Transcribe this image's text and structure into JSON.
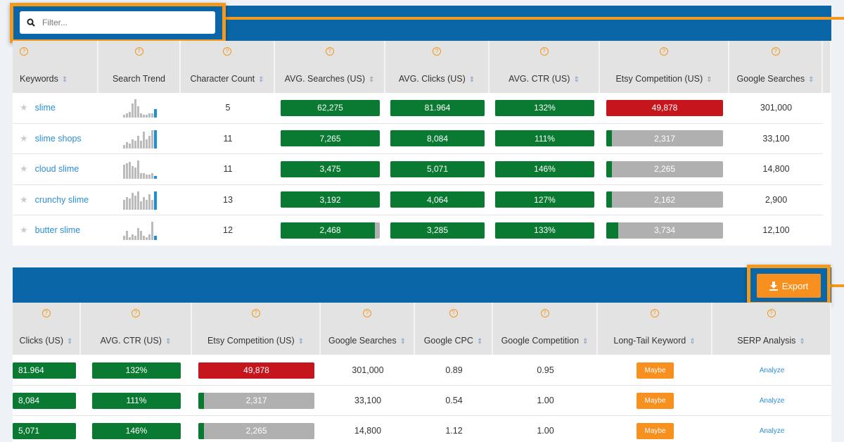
{
  "colors": {
    "header_blue": "#0a66a6",
    "highlight": "#f39a1e",
    "green": "#0a7a32",
    "red": "#c4161c",
    "gray": "#b0b0b0",
    "link": "#2a8fd6"
  },
  "filter": {
    "placeholder": "Filter...",
    "icon": "search-icon"
  },
  "export": {
    "label": "Export",
    "icon": "download-icon"
  },
  "top_table": {
    "columns": [
      "Keywords",
      "Search Trend",
      "Character Count",
      "AVG. Searches (US)",
      "AVG. Clicks (US)",
      "AVG. CTR (US)",
      "Etsy Competition (US)",
      "Google Searches"
    ],
    "rows": [
      {
        "keyword": "slime",
        "trend": [
          2,
          3,
          4,
          10,
          13,
          8,
          3,
          2,
          2,
          3,
          3,
          6
        ],
        "chars": "5",
        "searches": "62,275",
        "searches_fill": 1,
        "clicks": "81.964",
        "ctr": "132%",
        "etsy": "49,878",
        "etsy_fill": 1,
        "etsy_color": "red",
        "google": "301,000"
      },
      {
        "keyword": "slime shops",
        "trend": [
          2,
          4,
          3,
          6,
          5,
          8,
          5,
          11,
          6,
          8,
          12,
          12
        ],
        "chars": "11",
        "searches": "7,265",
        "searches_fill": 1,
        "clicks": "8,084",
        "ctr": "111%",
        "etsy": "2,317",
        "etsy_fill": 0.05,
        "etsy_color": "green",
        "google": "33,100"
      },
      {
        "keyword": "cloud slime",
        "trend": [
          10,
          11,
          12,
          9,
          8,
          13,
          4,
          4,
          3,
          3,
          4,
          2
        ],
        "chars": "11",
        "searches": "3,475",
        "searches_fill": 1,
        "clicks": "5,071",
        "ctr": "146%",
        "etsy": "2,265",
        "etsy_fill": 0.05,
        "etsy_color": "green",
        "google": "14,800"
      },
      {
        "keyword": "crunchy slime",
        "trend": [
          7,
          9,
          8,
          12,
          10,
          13,
          6,
          9,
          7,
          11,
          7,
          13
        ],
        "chars": "13",
        "searches": "3,192",
        "searches_fill": 1,
        "clicks": "4,064",
        "ctr": "127%",
        "etsy": "2,162",
        "etsy_fill": 0.05,
        "etsy_color": "green",
        "google": "2,900"
      },
      {
        "keyword": "butter slime",
        "trend": [
          3,
          6,
          2,
          4,
          3,
          8,
          6,
          3,
          2,
          4,
          12,
          3
        ],
        "chars": "12",
        "searches": "2,468",
        "searches_fill": 0.95,
        "clicks": "3,285",
        "ctr": "133%",
        "etsy": "3,734",
        "etsy_fill": 0.1,
        "etsy_color": "green",
        "google": "12,100"
      }
    ]
  },
  "bottom_table": {
    "columns": [
      "Clicks (US)",
      "AVG. CTR (US)",
      "Etsy Competition (US)",
      "Google Searches",
      "Google CPC",
      "Google Competition",
      "Long-Tail Keyword",
      "SERP Analysis"
    ],
    "rows": [
      {
        "clicks": "81.964",
        "ctr": "132%",
        "etsy": "49,878",
        "etsy_fill": 1,
        "etsy_color": "red",
        "google": "301,000",
        "cpc": "0.89",
        "gcomp": "0.95",
        "longtail": "Maybe",
        "serp": "Analyze"
      },
      {
        "clicks": "8,084",
        "ctr": "111%",
        "etsy": "2,317",
        "etsy_fill": 0.05,
        "etsy_color": "green",
        "google": "33,100",
        "cpc": "0.54",
        "gcomp": "1.00",
        "longtail": "Maybe",
        "serp": "Analyze"
      },
      {
        "clicks": "5,071",
        "ctr": "146%",
        "etsy": "2,265",
        "etsy_fill": 0.05,
        "etsy_color": "green",
        "google": "14,800",
        "cpc": "1.12",
        "gcomp": "1.00",
        "longtail": "Maybe",
        "serp": "Analyze"
      }
    ]
  }
}
